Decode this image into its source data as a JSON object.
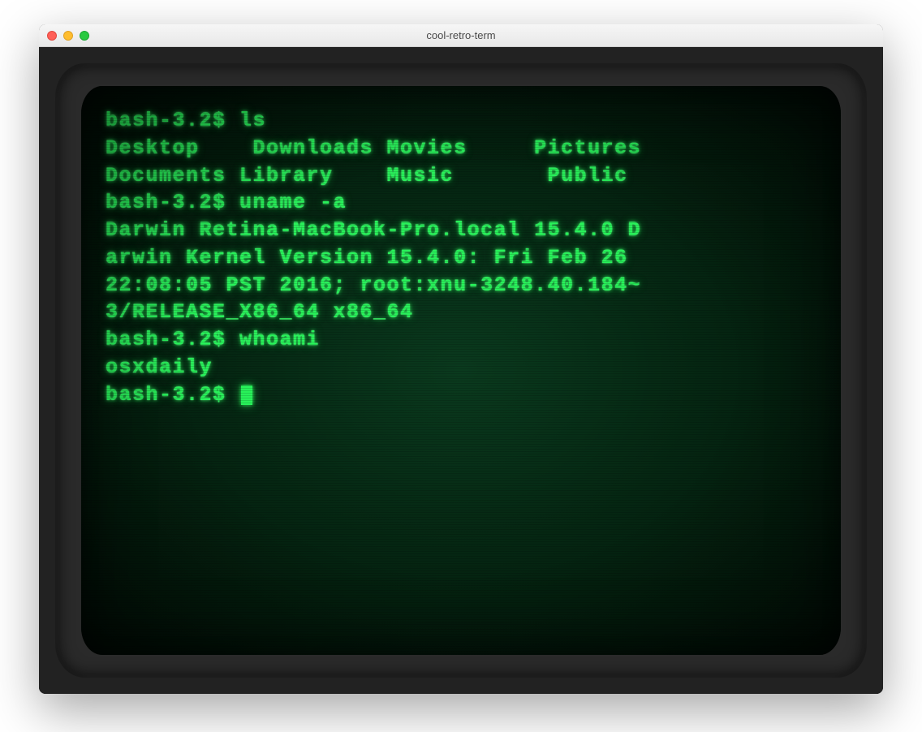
{
  "window": {
    "title": "cool-retro-term"
  },
  "terminal": {
    "prompt": "bash-3.2$ ",
    "lines": [
      "bash-3.2$ ls",
      "Desktop    Downloads Movies     Pictures",
      "Documents Library    Music       Public",
      "bash-3.2$ uname -a",
      "Darwin Retina-MacBook-Pro.local 15.4.0 D",
      "arwin Kernel Version 15.4.0: Fri Feb 26 ",
      "22:08:05 PST 2016; root:xnu-3248.40.184~",
      "3/RELEASE_X86_64 x86_64",
      "bash-3.2$ whoami",
      "osxdaily"
    ],
    "current_prompt": "bash-3.2$ "
  },
  "colors": {
    "phosphor_green": "#28f25a",
    "screen_bg": "#052612"
  }
}
